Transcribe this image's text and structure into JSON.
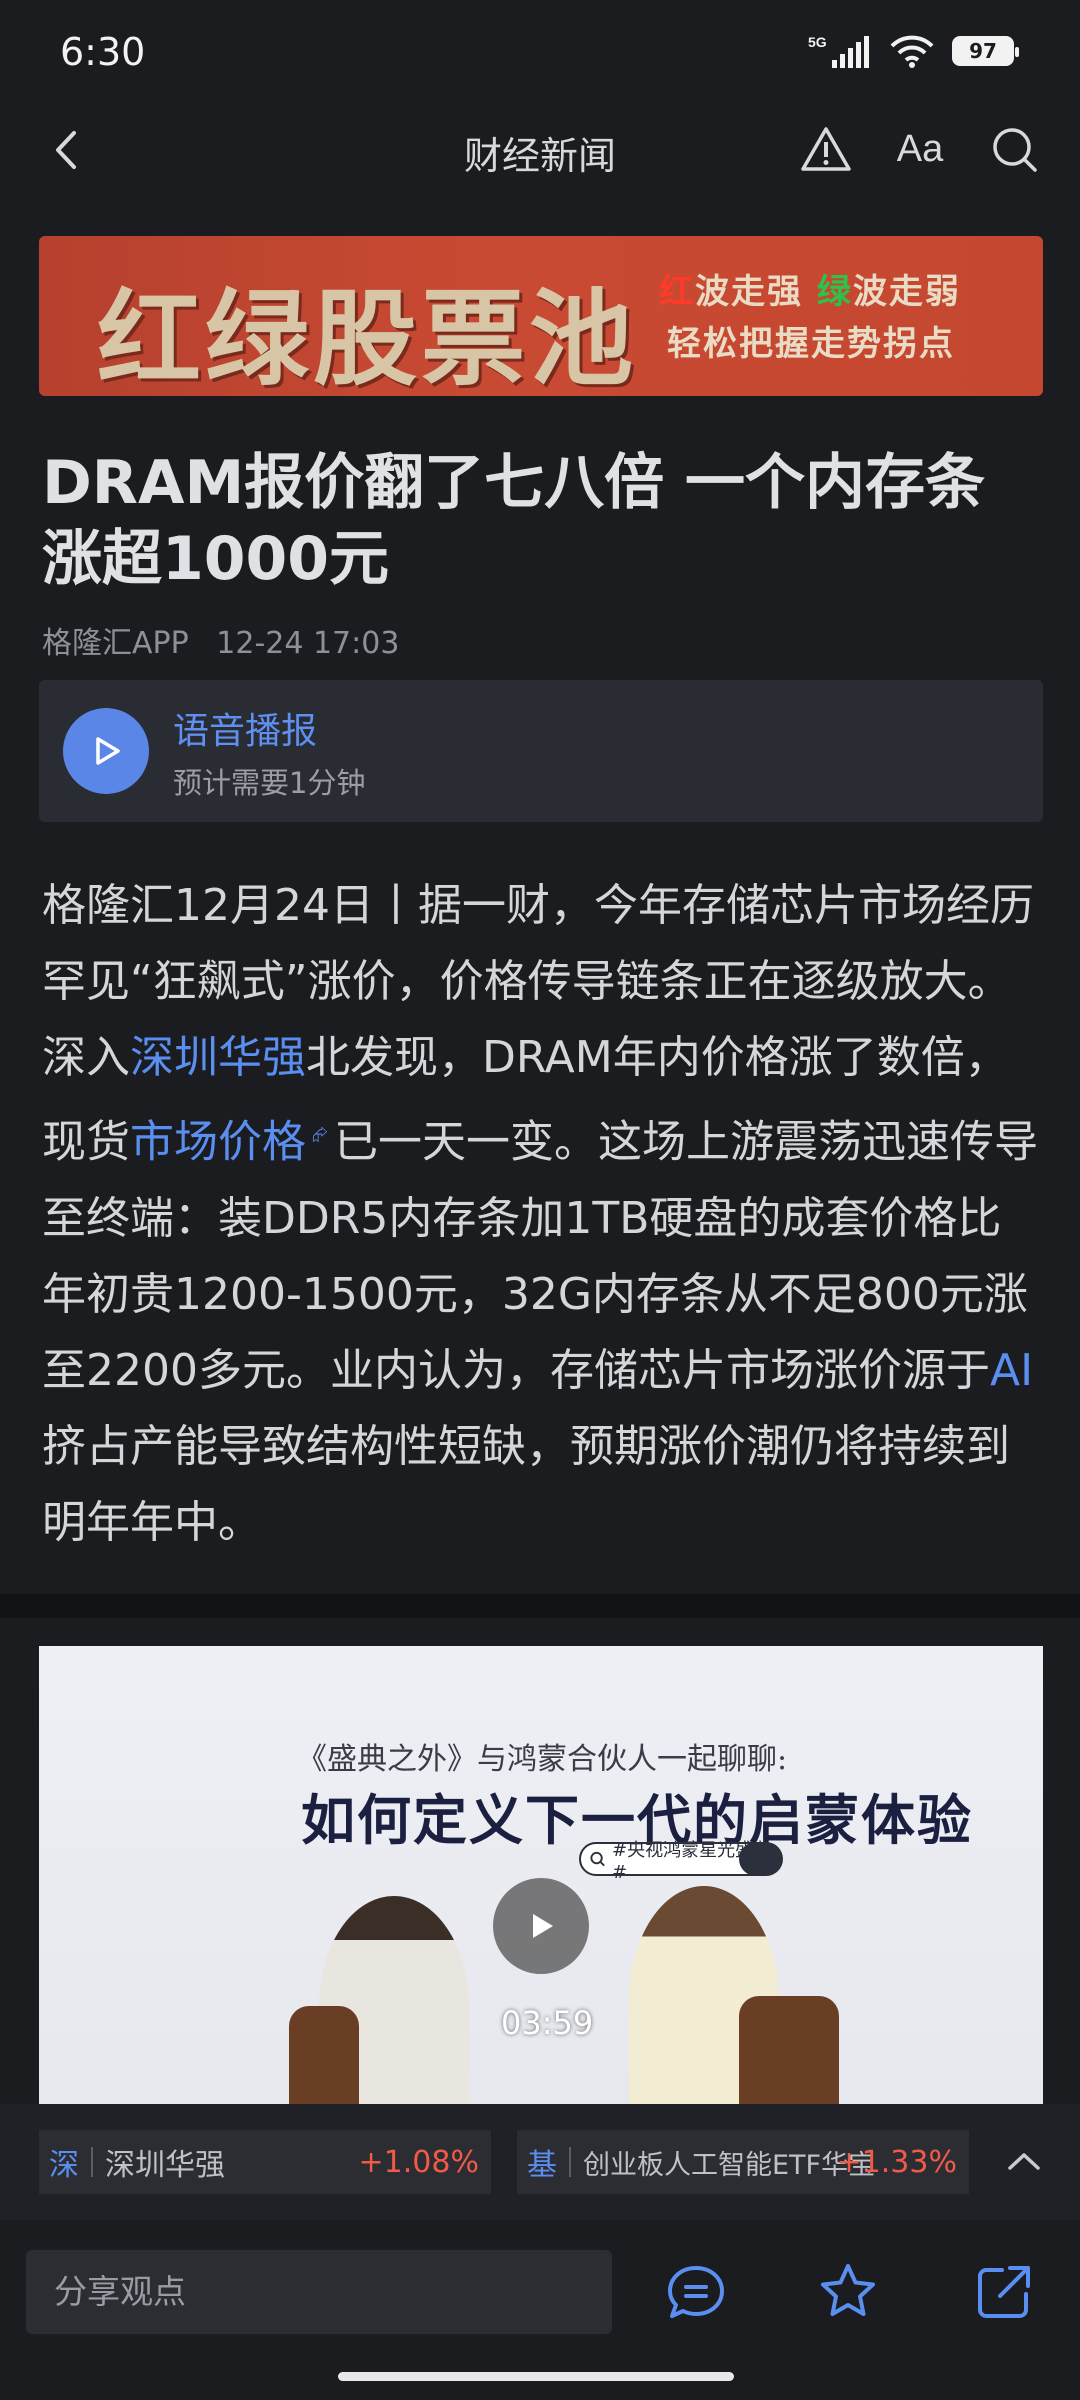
{
  "status_bar": {
    "time": "6:30",
    "network": "5G",
    "battery": "97"
  },
  "nav": {
    "title": "财经新闻",
    "font_label": "Aa"
  },
  "banner": {
    "main": "红绿股票池",
    "sub1_a": "红",
    "sub1_b": "波走强 ",
    "sub1_c": "绿",
    "sub1_d": "波走弱",
    "sub2": "轻松把握走势拐点"
  },
  "article": {
    "headline": "DRAM报价翻了七八倍 一个内存条涨超1000元",
    "source": "格隆汇APP",
    "datetime": "12-24 17:03",
    "audio": {
      "title": "语音播报",
      "duration": "预计需要1分钟"
    },
    "body": {
      "p1": "格隆汇12月24日丨据一财，今年存储芯片市场经历罕见“狂飙式”涨价，价格传导链条正在逐级放大。深入",
      "link1": "深圳华强",
      "p2": "北发现，DRAM年内价格涨了数倍，现货",
      "link2": "市场价格",
      "p3": "已一天一变。这场上游震荡迅速传导至终端：装DDR5内存条加1TB硬盘的成套价格比年初贵1200-1500元，32G内存条从不足800元涨至2200多元。业内认为，存储芯片市场涨价源于",
      "link3": "AI",
      "p4": "挤占产能导致结构性短缺，预期涨价潮仍将持续到明年年中。"
    }
  },
  "video": {
    "caption_small": "《盛典之外》与鸿蒙合伙人一起聊聊:",
    "caption_large": "如何定义下一代的启蒙体验",
    "tag": "#央视鸿蒙星光盛典#",
    "duration": "03:59"
  },
  "stocks": [
    {
      "tag": "深",
      "name": "深圳华强",
      "change": "+1.08%"
    },
    {
      "tag": "基",
      "name": "创业板人工智能ETF华宝",
      "change": "+1.33%"
    }
  ],
  "bottom": {
    "comment_placeholder": "分享观点"
  }
}
